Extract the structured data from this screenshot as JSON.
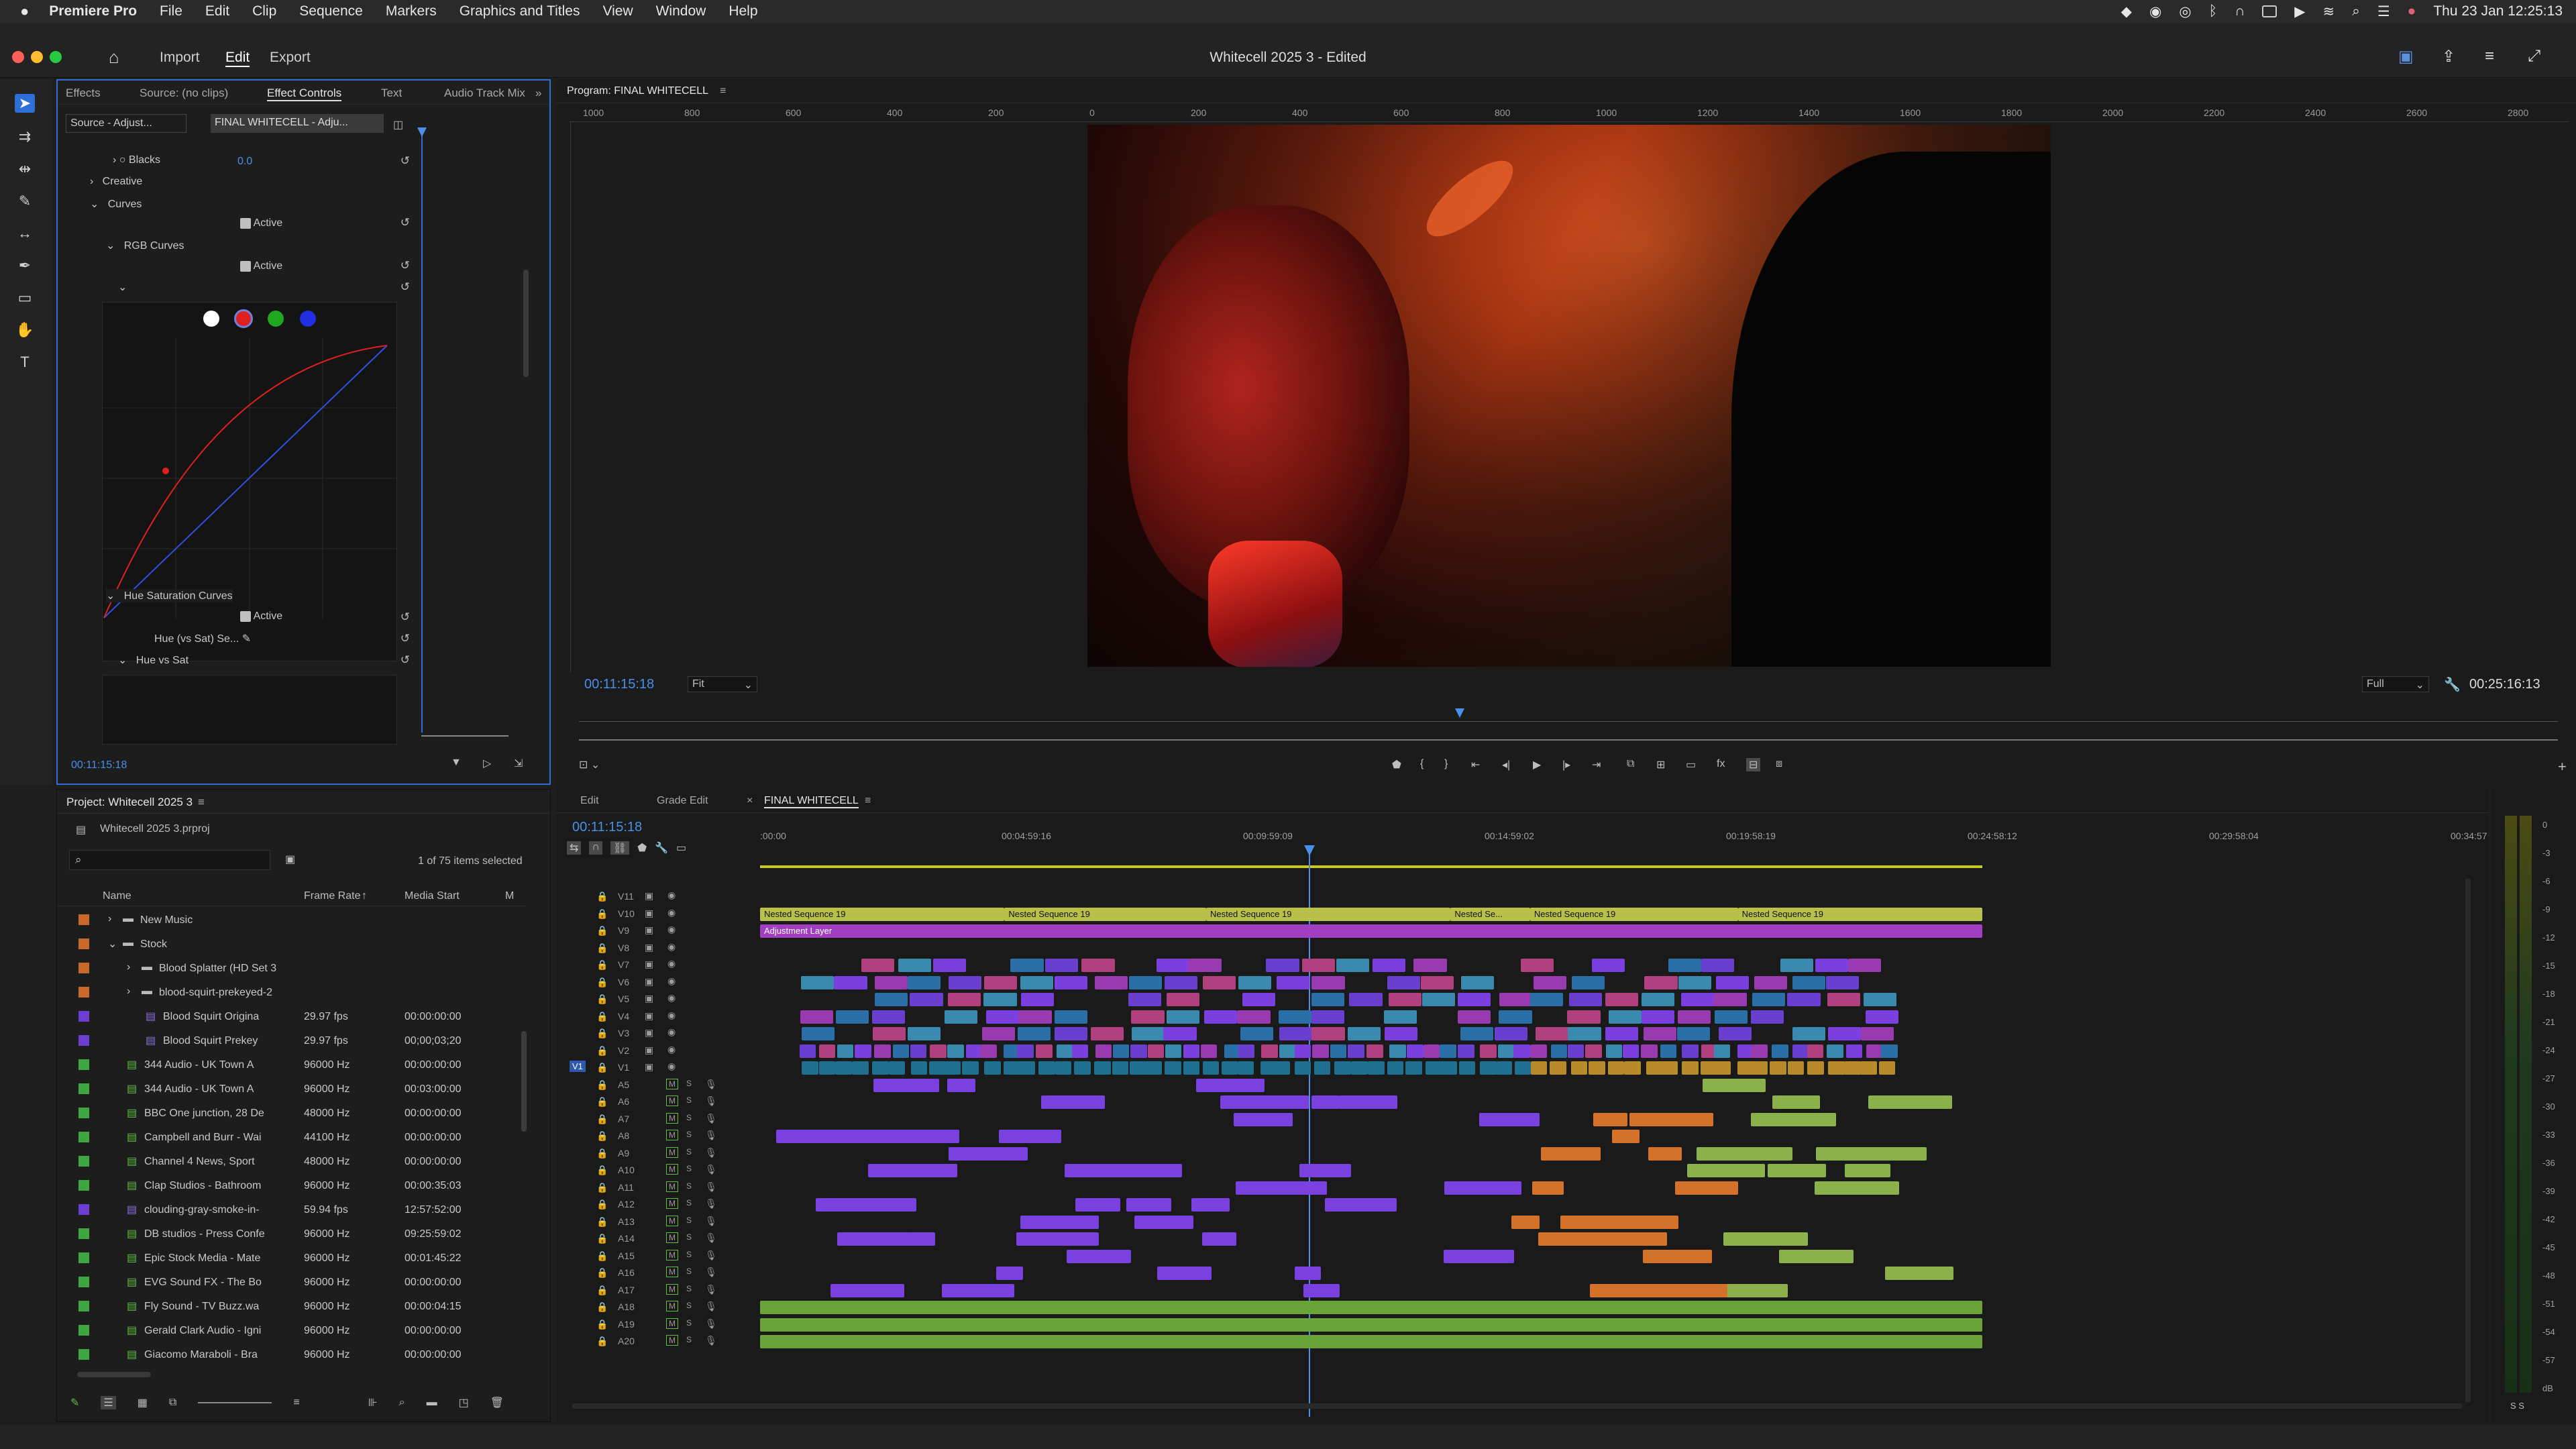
{
  "menubar": {
    "app_name": "Premiere Pro",
    "items": [
      "File",
      "Edit",
      "Clip",
      "Sequence",
      "Markers",
      "Graphics and Titles",
      "View",
      "Window",
      "Help"
    ],
    "clock": "Thu 23 Jan  12:25:13"
  },
  "window": {
    "title": "Whitecell 2025 3 - Edited",
    "workspaces": [
      "Import",
      "Edit",
      "Export"
    ],
    "active_workspace": "Edit"
  },
  "effects_panel": {
    "tabs": [
      "Effects",
      "Source: (no clips)",
      "Effect Controls",
      "Text",
      "Audio Track Mixer"
    ],
    "active_tab": "Effect Controls",
    "source_tab": "Source - Adjust...",
    "sequence_tab": "FINAL WHITECELL - Adju...",
    "timecode": "00:11:15:18",
    "rows": {
      "blacks_label": "Blacks",
      "blacks_value": "0.0",
      "creative": "Creative",
      "curves": "Curves",
      "active": "Active",
      "rgb_curves": "RGB Curves",
      "hue_sat_curves": "Hue Saturation Curves",
      "hue_vs_sat_sel": "Hue (vs Sat) Se...",
      "hue_vs_sat": "Hue vs Sat"
    },
    "curve_colors": [
      "#ffffff",
      "#e02020",
      "#1fa81f",
      "#2030e0"
    ]
  },
  "project_panel": {
    "title": "Project: Whitecell 2025 3",
    "file": "Whitecell 2025 3.prproj",
    "selection_count": "1 of 75 items selected",
    "columns": [
      "Name",
      "Frame Rate",
      "Media Start",
      "M"
    ],
    "items": [
      {
        "name": "New Music",
        "rate": "",
        "start": "",
        "color": "#c96a2b",
        "type": "folder",
        "indent": 1
      },
      {
        "name": "Stock",
        "rate": "",
        "start": "",
        "color": "#c96a2b",
        "type": "folder",
        "indent": 1
      },
      {
        "name": "Blood Splatter (HD Set 3",
        "rate": "",
        "start": "",
        "color": "#c96a2b",
        "type": "folder",
        "indent": 2
      },
      {
        "name": "blood-squirt-prekeyed-2",
        "rate": "",
        "start": "",
        "color": "#c96a2b",
        "type": "folder",
        "indent": 2
      },
      {
        "name": "Blood Squirt Origina",
        "rate": "29.97 fps",
        "start": "00:00:00:00",
        "color": "#6b3fd1",
        "type": "clip",
        "indent": 3
      },
      {
        "name": "Blood Squirt Prekey",
        "rate": "29.97 fps",
        "start": "00;00;03;20",
        "color": "#6b3fd1",
        "type": "clip",
        "indent": 3
      },
      {
        "name": "344 Audio - UK Town A",
        "rate": "96000 Hz",
        "start": "00:00:00:00",
        "color": "#3fa63f",
        "type": "audio",
        "indent": 2
      },
      {
        "name": "344 Audio - UK Town A",
        "rate": "96000 Hz",
        "start": "00:03:00:00",
        "color": "#3fa63f",
        "type": "audio",
        "indent": 2
      },
      {
        "name": "BBC One junction, 28 De",
        "rate": "48000 Hz",
        "start": "00:00:00:00",
        "color": "#3fa63f",
        "type": "audio",
        "indent": 2
      },
      {
        "name": "Campbell and Burr - Wai",
        "rate": "44100 Hz",
        "start": "00:00:00:00",
        "color": "#3fa63f",
        "type": "audio",
        "indent": 2
      },
      {
        "name": "Channel 4 News, Sport",
        "rate": "48000 Hz",
        "start": "00:00:00:00",
        "color": "#3fa63f",
        "type": "audio",
        "indent": 2
      },
      {
        "name": "Clap Studios - Bathroom",
        "rate": "96000 Hz",
        "start": "00:00:35:03",
        "color": "#3fa63f",
        "type": "audio",
        "indent": 2
      },
      {
        "name": "clouding-gray-smoke-in-",
        "rate": "59.94 fps",
        "start": "12:57:52:00",
        "color": "#6b3fd1",
        "type": "clip",
        "indent": 2
      },
      {
        "name": "DB studios - Press Confe",
        "rate": "96000 Hz",
        "start": "09:25:59:02",
        "color": "#3fa63f",
        "type": "audio",
        "indent": 2
      },
      {
        "name": "Epic Stock Media - Mate",
        "rate": "96000 Hz",
        "start": "00:01:45:22",
        "color": "#3fa63f",
        "type": "audio",
        "indent": 2
      },
      {
        "name": "EVG Sound FX - The Bo",
        "rate": "96000 Hz",
        "start": "00:00:00:00",
        "color": "#3fa63f",
        "type": "audio",
        "indent": 2
      },
      {
        "name": "Fly Sound - TV Buzz.wa",
        "rate": "96000 Hz",
        "start": "00:00:04:15",
        "color": "#3fa63f",
        "type": "audio",
        "indent": 2
      },
      {
        "name": "Gerald Clark Audio - Igni",
        "rate": "96000 Hz",
        "start": "00:00:00:00",
        "color": "#3fa63f",
        "type": "audio",
        "indent": 2
      },
      {
        "name": "Giacomo Maraboli - Bra",
        "rate": "96000 Hz",
        "start": "00:00:00:00",
        "color": "#3fa63f",
        "type": "audio",
        "indent": 2
      }
    ]
  },
  "program_monitor": {
    "title": "Program: FINAL WHITECELL",
    "ruler_labels": [
      "1000",
      "800",
      "600",
      "400",
      "200",
      "0",
      "200",
      "400",
      "600",
      "800",
      "1000",
      "1200",
      "1400",
      "1600",
      "1800",
      "2000",
      "2200",
      "2400",
      "2600",
      "2800"
    ],
    "timecode": "00:11:15:18",
    "fit": "Fit",
    "quality": "Full",
    "duration": "00:25:16:13"
  },
  "timeline": {
    "tabs": [
      "Edit",
      "Grade Edit",
      "FINAL WHITECELL"
    ],
    "active_tab": "FINAL WHITECELL",
    "timecode": "00:11:15:18",
    "ruler_labels": [
      ":00:00",
      "00:04:59:16",
      "00:09:59:09",
      "00:14:59:02",
      "00:19:58:19",
      "00:24:58:12",
      "00:29:58:04",
      "00:34:57"
    ],
    "video_tracks": [
      "V11",
      "V10",
      "V9",
      "V8",
      "V7",
      "V6",
      "V5",
      "V4",
      "V3",
      "V2",
      "V1"
    ],
    "audio_tracks": [
      "A5",
      "A6",
      "A7",
      "A8",
      "A9",
      "A10",
      "A11",
      "A12",
      "A13",
      "A14",
      "A15",
      "A16",
      "A17",
      "A18",
      "A19",
      "A20"
    ],
    "nested_label": "Nested Sequence 19",
    "nested_short": "Nested Se...",
    "adjustment_label": "Adjustment Layer",
    "fx": "fx"
  },
  "meter": {
    "labels": [
      "0",
      "-3",
      "-6",
      "-9",
      "-12",
      "-15",
      "-18",
      "-21",
      "-24",
      "-27",
      "-30",
      "-33",
      "-36",
      "-39",
      "-42",
      "-45",
      "-48",
      "-51",
      "-54",
      "-57",
      "dB"
    ],
    "solo": "S  S"
  }
}
